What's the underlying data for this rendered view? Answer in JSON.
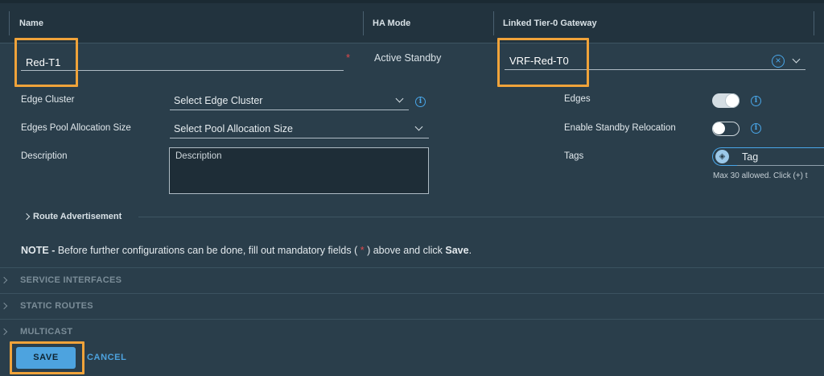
{
  "header": {
    "col_name": "Name",
    "col_ha_mode": "HA Mode",
    "col_linked_gateway": "Linked Tier-0 Gateway"
  },
  "row": {
    "name_value": "Red-T1",
    "required_marker": "*",
    "ha_mode_value": "Active Standby",
    "linked_gateway_value": "VRF-Red-T0"
  },
  "form": {
    "edge_cluster_label": "Edge Cluster",
    "edge_cluster_placeholder": "Select Edge Cluster",
    "pool_label": "Edges Pool Allocation Size",
    "pool_placeholder": "Select Pool Allocation Size",
    "description_label": "Description",
    "description_placeholder": "Description",
    "edges_label": "Edges",
    "edges_toggle_on": true,
    "standby_label": "Enable Standby Relocation",
    "standby_toggle_on": false,
    "tags_label": "Tags",
    "tag_placeholder": "Tag",
    "tags_hint": "Max 30 allowed. Click (+) t"
  },
  "route_advertisement": "Route Advertisement",
  "note": {
    "prefix": "NOTE -",
    "text_before": " Before further configurations can be done, fill out mandatory fields ( ",
    "asterisk": "*",
    "text_after": " ) above and click ",
    "save_word": "Save",
    "period": "."
  },
  "sections": {
    "service_interfaces": "SERVICE INTERFACES",
    "static_routes": "STATIC ROUTES",
    "multicast": "MULTICAST"
  },
  "buttons": {
    "save": "SAVE",
    "cancel": "CANCEL"
  },
  "colors": {
    "accent": "#4da3df",
    "highlight": "#f0a33a",
    "required": "#e0484b",
    "background": "#2a3e4b"
  }
}
